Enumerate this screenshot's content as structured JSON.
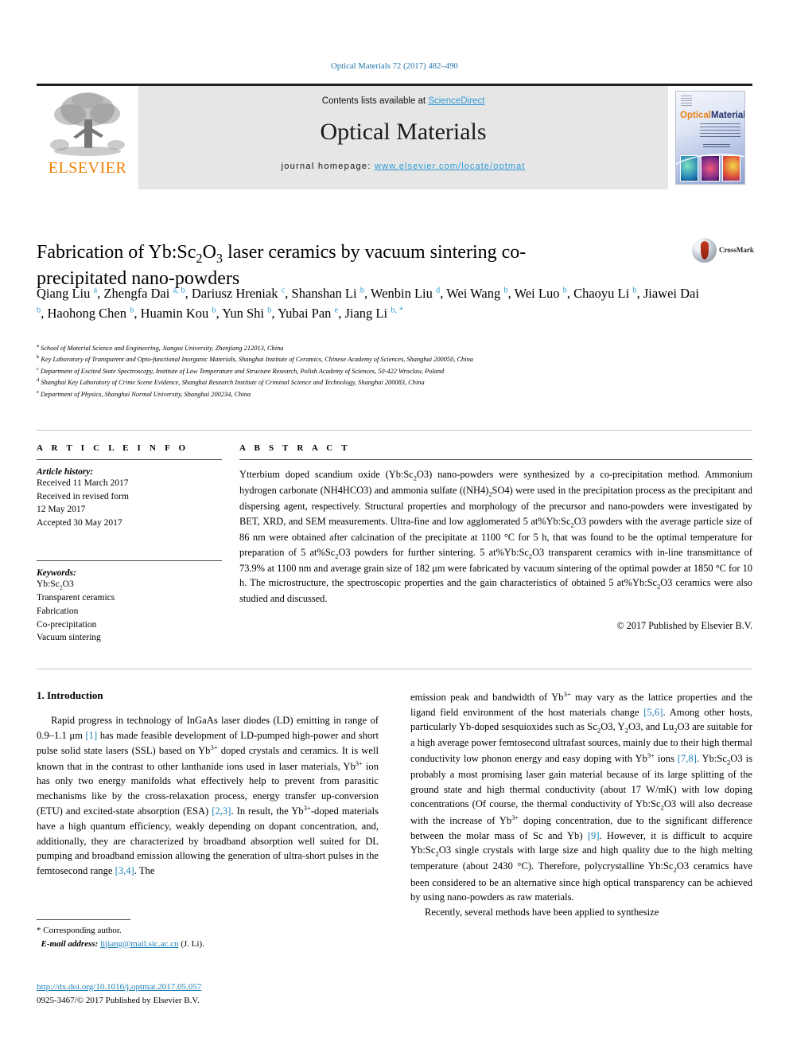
{
  "running_head": "Optical Materials 72 (2017) 482–490",
  "banner": {
    "publisher_word": "ELSEVIER",
    "publisher_logo": "elsevier-tree-logo",
    "contents_prefix": "Contents lists available at ",
    "contents_link": "ScienceDirect",
    "journal_name": "Optical Materials",
    "homepage_prefix": "journal homepage: ",
    "homepage_url": "www.elsevier.com/locate/optmat",
    "cover": {
      "title_part1": "Optical",
      "title_part2": "Materials"
    }
  },
  "article": {
    "title_line1": "Fabrication of Yb:Sc",
    "title_sub1": "2",
    "title_mid": "O",
    "title_sub2": "3",
    "title_line1_end": " laser ceramics by vacuum sintering co-",
    "title_line2": "precipitated nano-powders",
    "crossmark_label": "CrossMark"
  },
  "authors": [
    {
      "name": "Qiang Liu",
      "marks": "a",
      "sep": ", "
    },
    {
      "name": "Zhengfa Dai",
      "marks": "a, b",
      "sep": ", "
    },
    {
      "name": "Dariusz Hreniak",
      "marks": "c",
      "sep": ", "
    },
    {
      "name": "Shanshan Li",
      "marks": "b",
      "sep": ", "
    },
    {
      "name": "Wenbin Liu",
      "marks": "d",
      "sep": ", "
    },
    {
      "name": "Wei Wang",
      "marks": "b",
      "sep": ", "
    },
    {
      "name": "Wei Luo",
      "marks": "b",
      "sep": ", "
    },
    {
      "name": "Chaoyu Li",
      "marks": "b",
      "sep": ", "
    },
    {
      "name": "Jiawei Dai",
      "marks": "b",
      "sep": ", "
    },
    {
      "name": "Haohong Chen",
      "marks": "b",
      "sep": ", "
    },
    {
      "name": "Huamin Kou",
      "marks": "b",
      "sep": ", "
    },
    {
      "name": "Yun Shi",
      "marks": "b",
      "sep": ", "
    },
    {
      "name": "Yubai Pan",
      "marks": "e",
      "sep": ", "
    },
    {
      "name": "Jiang Li",
      "marks": "b, *",
      "sep": ""
    }
  ],
  "affiliations": [
    {
      "label": "a",
      "text": "School of Material Science and Engineering, Jiangsu University, Zhenjiang 212013, China"
    },
    {
      "label": "b",
      "text": "Key Laboratory of Transparent and Opto-functional Inorganic Materials, Shanghai Institute of Ceramics, Chinese Academy of Sciences, Shanghai 200050, China"
    },
    {
      "label": "c",
      "text": "Department of Excited State Spectroscopy, Institute of Low Temperature and Structure Research, Polish Academy of Sciences, 50-422 Wroclaw, Poland"
    },
    {
      "label": "d",
      "text": "Shanghai Key Laboratory of Crime Scene Evidence, Shanghai Research Institute of Criminal Science and Technology, Shanghai 200083, China"
    },
    {
      "label": "e",
      "text": "Department of Physics, Shanghai Normal University, Shanghai 200234, China"
    }
  ],
  "article_info": {
    "heading": "A R T I C L E  I N F O",
    "history_label": "Article history:",
    "history": [
      "Received 11 March 2017",
      "Received in revised form",
      "12 May 2017",
      "Accepted 30 May 2017"
    ],
    "keywords_label": "Keywords:",
    "keywords": [
      "Yb:Sc2O3",
      "Transparent ceramics",
      "Fabrication",
      "Co-precipitation",
      "Vacuum sintering"
    ]
  },
  "abstract": {
    "heading": "A B S T R A C T",
    "text": "Ytterbium doped scandium oxide (Yb:Sc2O3) nano-powders were synthesized by a co-precipitation method. Ammonium hydrogen carbonate (NH4HCO3) and ammonia sulfate ((NH4)2SO4) were used in the precipitation process as the precipitant and dispersing agent, respectively. Structural properties and morphology of the precursor and nano-powders were investigated by BET, XRD, and SEM measurements. Ultra-fine and low agglomerated 5 at%Yb:Sc2O3 powders with the average particle size of 86 nm were obtained after calcination of the precipitate at 1100 °C for 5 h, that was found to be the optimal temperature for preparation of 5 at%Sc2O3 powders for further sintering. 5 at%Yb:Sc2O3 transparent ceramics with in-line transmittance of 73.9% at 1100 nm and average grain size of 182 μm were fabricated by vacuum sintering of the optimal powder at 1850 °C for 10 h. The microstructure, the spectroscopic properties and the gain characteristics of obtained 5 at%Yb:Sc2O3 ceramics were also studied and discussed.",
    "copyright": "© 2017 Published by Elsevier B.V."
  },
  "body": {
    "section_heading": "1. Introduction",
    "left_paragraph": "Rapid progress in technology of InGaAs laser diodes (LD) emitting in range of 0.9–1.1 μm [1] has made feasible development of LD-pumped high-power and short pulse solid state lasers (SSL) based on Yb3+ doped crystals and ceramics. It is well known that in the contrast to other lanthanide ions used in laser materials, Yb3+ ion has only two energy manifolds what effectively help to prevent from parasitic mechanisms like by the cross-relaxation process, energy transfer up-conversion (ETU) and excited-state absorption (ESA) [2,3]. In result, the Yb3+-doped materials have a high quantum efficiency, weakly depending on dopant concentration, and, additionally, they are characterized by broadband absorption well suited for DL pumping and broadband emission allowing the generation of ultra-short pulses in the femtosecond range [3,4]. The",
    "right_paragraph": "emission peak and bandwidth of Yb3+ may vary as the lattice properties and the ligand field environment of the host materials change [5,6]. Among other hosts, particularly Yb-doped sesquioxides such as Sc2O3, Y2O3, and Lu2O3 are suitable for a high average power femtosecond ultrafast sources, mainly due to their high thermal conductivity low phonon energy and easy doping with Yb3+ ions [7,8]. Yb:Sc2O3 is probably a most promising laser gain material because of its large splitting of the ground state and high thermal conductivity (about 17 W/mK) with low doping concentrations (Of course, the thermal conductivity of Yb:Sc2O3 will also decrease with the increase of Yb3+ doping concentration, due to the significant difference between the molar mass of Sc and Yb) [9]. However, it is difficult to acquire Yb:Sc2O3 single crystals with large size and high quality due to the high melting temperature (about 2430 °C). Therefore, polycrystalline Yb:Sc2O3 ceramics have been considered to be an alternative since high optical transparency can be achieved by using nano-powders as raw materials.",
    "right_paragraph2": "Recently, several methods have been applied to synthesize"
  },
  "footnote": {
    "corresponding": "* Corresponding author.",
    "email_label": "E-mail address: ",
    "email": "lijiang@mail.sic.ac.cn",
    "email_suffix": " (J. Li)."
  },
  "page_footer": {
    "doi": "http://dx.doi.org/10.1016/j.optmat.2017.05.057",
    "issn_line": "0925-3467/© 2017 Published by Elsevier B.V."
  },
  "colors": {
    "link_blue": "#1b7fb8",
    "sciencedirect_blue": "#2e9bd6",
    "elsevier_orange": "#f07d00"
  }
}
